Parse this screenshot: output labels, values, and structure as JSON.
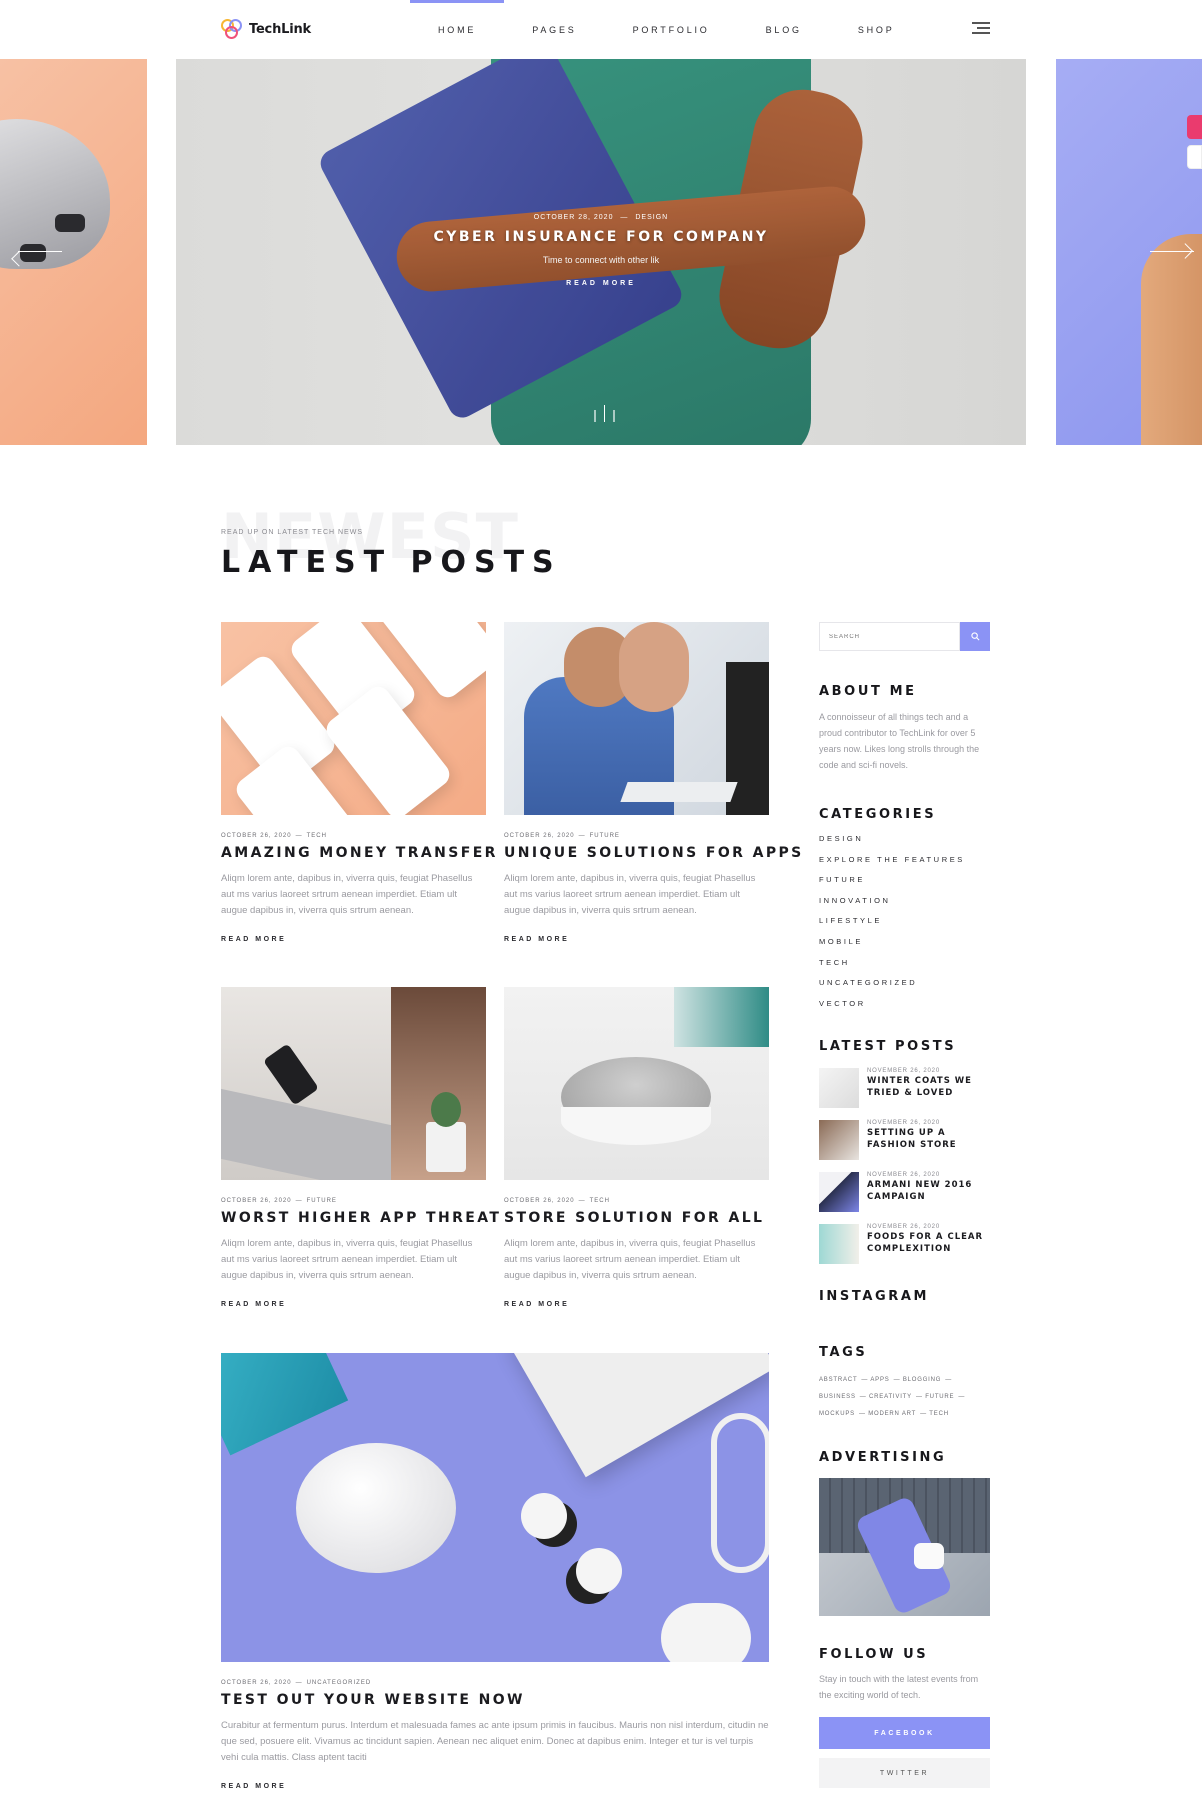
{
  "brand": {
    "name": "TechLink"
  },
  "nav": {
    "items": [
      "HOME",
      "PAGES",
      "PORTFOLIO",
      "BLOG",
      "SHOP"
    ],
    "active": "HOME"
  },
  "colors": {
    "accent": "#8b93f5",
    "text": "#1b1b1f",
    "muted": "#9a9aa0"
  },
  "hero": {
    "date": "OCTOBER 28, 2020",
    "category": "DESIGN",
    "title": "CYBER INSURANCE FOR COMPANY",
    "subtitle": "Time to connect with other lik",
    "link": "READ MORE"
  },
  "section": {
    "bg_word": "NEWEST",
    "kicker": "READ UP ON LATEST TECH NEWS",
    "title": "LATEST POSTS"
  },
  "posts": [
    {
      "date": "OCTOBER 26, 2020",
      "category": "TECH",
      "title": "AMAZING MONEY TRANSFER",
      "excerpt": "Aliqm lorem ante, dapibus in, viverra quis, feugiat Phasellus aut ms varius laoreet srtrum aenean imperdiet. Etiam ult augue dapibus in, viverra quis srtrum aenean.",
      "link": "READ MORE"
    },
    {
      "date": "OCTOBER 26, 2020",
      "category": "FUTURE",
      "title": "UNIQUE SOLUTIONS FOR APPS",
      "excerpt": "Aliqm lorem ante, dapibus in, viverra quis, feugiat Phasellus aut ms varius laoreet srtrum aenean imperdiet. Etiam ult augue dapibus in, viverra quis srtrum aenean.",
      "link": "READ MORE"
    },
    {
      "date": "OCTOBER 26, 2020",
      "category": "FUTURE",
      "title": "WORST HIGHER APP THREAT",
      "excerpt": "Aliqm lorem ante, dapibus in, viverra quis, feugiat Phasellus aut ms varius laoreet srtrum aenean imperdiet. Etiam ult augue dapibus in, viverra quis srtrum aenean.",
      "link": "READ MORE"
    },
    {
      "date": "OCTOBER 26, 2020",
      "category": "TECH",
      "title": "STORE SOLUTION FOR ALL",
      "excerpt": "Aliqm lorem ante, dapibus in, viverra quis, feugiat Phasellus aut ms varius laoreet srtrum aenean imperdiet. Etiam ult augue dapibus in, viverra quis srtrum aenean.",
      "link": "READ MORE"
    },
    {
      "date": "OCTOBER 26, 2020",
      "category": "UNCATEGORIZED",
      "title": "TEST OUT YOUR WEBSITE NOW",
      "excerpt": "Curabitur at fermentum purus. Interdum et malesuada fames ac ante ipsum primis in faucibus. Mauris non nisl interdum, citudin ne que sed, posuere elit. Vivamus ac tincidunt sapien. Aenean nec aliquet enim. Donec at dapibus enim. Integer et tur is vel turpis vehi cula mattis. Class aptent taciti",
      "link": "READ MORE"
    }
  ],
  "sidebar": {
    "search_placeholder": "SEARCH",
    "about": {
      "title": "ABOUT ME",
      "text": "A connoisseur of all things tech and a proud contributor to TechLink for over 5 years now. Likes long strolls through the code and sci-fi novels."
    },
    "categories": {
      "title": "CATEGORIES",
      "items": [
        "DESIGN",
        "EXPLORE THE FEATURES",
        "FUTURE",
        "INNOVATION",
        "LIFESTYLE",
        "MOBILE",
        "TECH",
        "UNCATEGORIZED",
        "VECTOR"
      ]
    },
    "latest": {
      "title": "LATEST POSTS",
      "items": [
        {
          "date": "NOVEMBER 26, 2020",
          "title": "WINTER COATS WE TRIED & LOVED"
        },
        {
          "date": "NOVEMBER 26, 2020",
          "title": "SETTING UP A FASHION STORE"
        },
        {
          "date": "NOVEMBER 26, 2020",
          "title": "ARMANI NEW 2016 CAMPAIGN"
        },
        {
          "date": "NOVEMBER 26, 2020",
          "title": "FOODS FOR A CLEAR COMPLEXITION"
        }
      ]
    },
    "instagram": {
      "title": "INSTAGRAM"
    },
    "tags": {
      "title": "TAGS",
      "items": [
        "ABSTRACT",
        "APPS",
        "BLOGGING",
        "BUSINESS",
        "CREATIVITY",
        "FUTURE",
        "MOCKUPS",
        "MODERN ART",
        "TECH"
      ]
    },
    "advertising": {
      "title": "ADVERTISING"
    },
    "follow": {
      "title": "FOLLOW US",
      "text": "Stay in touch with the latest events from the exciting world of tech.",
      "facebook": "FACEBOOK",
      "twitter": "TWITTER"
    }
  }
}
